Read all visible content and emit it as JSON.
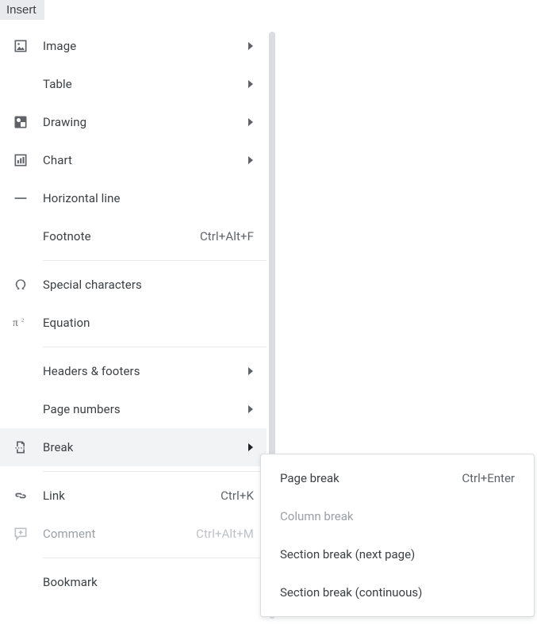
{
  "menuTab": "Insert",
  "menu": {
    "image": "Image",
    "table": "Table",
    "drawing": "Drawing",
    "chart": "Chart",
    "horizontal_line": "Horizontal line",
    "footnote": "Footnote",
    "footnote_shortcut": "Ctrl+Alt+F",
    "special_characters": "Special characters",
    "equation": "Equation",
    "headers_footers": "Headers & footers",
    "page_numbers": "Page numbers",
    "break": "Break",
    "link": "Link",
    "link_shortcut": "Ctrl+K",
    "comment": "Comment",
    "comment_shortcut": "Ctrl+Alt+M",
    "bookmark": "Bookmark"
  },
  "submenu": {
    "page_break": "Page break",
    "page_break_shortcut": "Ctrl+Enter",
    "column_break": "Column break",
    "section_next": "Section break (next page)",
    "section_cont": "Section break (continuous)"
  },
  "colors": {
    "text": "#3c4043",
    "muted": "#9aa0a6",
    "hover": "#f1f3f4",
    "divider": "#e8eaed"
  }
}
